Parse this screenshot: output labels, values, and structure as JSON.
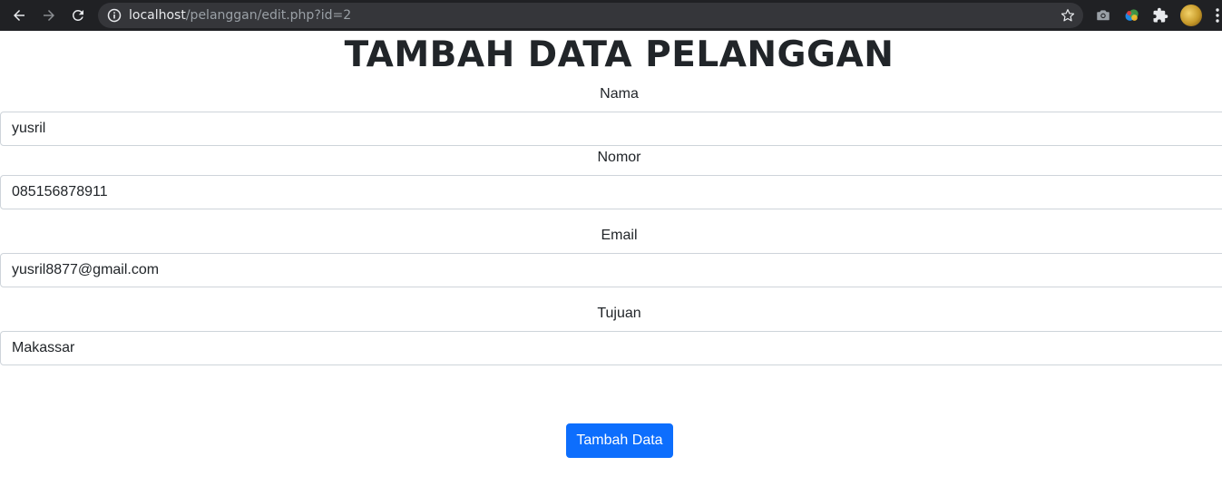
{
  "browser": {
    "url_host": "localhost",
    "url_path": "/pelanggan/edit.php?id=2",
    "icons": [
      "back-arrow-icon",
      "forward-arrow-icon",
      "reload-icon",
      "info-icon",
      "star-icon",
      "camera-icon",
      "extension-colorful-icon",
      "puzzle-icon",
      "profile-avatar",
      "more-menu-icon"
    ]
  },
  "page": {
    "title": "TAMBAH DATA PELANGGAN",
    "fields": [
      {
        "label": "Nama",
        "value": "yusril"
      },
      {
        "label": "Nomor",
        "value": "085156878911"
      },
      {
        "label": "Email",
        "value": "yusril8877@gmail.com"
      },
      {
        "label": "Tujuan",
        "value": "Makassar"
      }
    ],
    "submit_label": "Tambah Data"
  },
  "colors": {
    "toolbar_bg": "#202124",
    "omnibox_bg": "#35363a",
    "button_primary": "#0d6efd",
    "input_border": "#ced4da",
    "text": "#212529"
  }
}
